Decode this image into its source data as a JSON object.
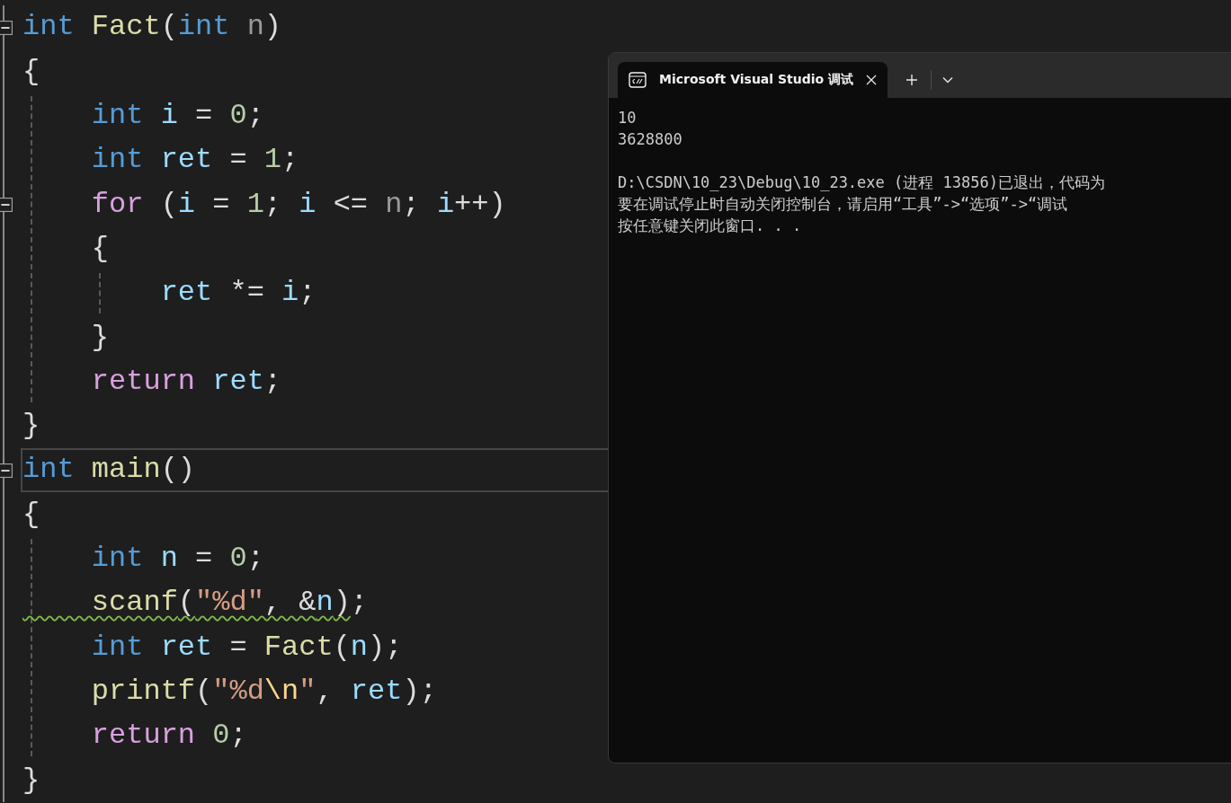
{
  "editor": {
    "lines": [
      {
        "fold": true,
        "current": false,
        "tokens": [
          {
            "kind": "keyword",
            "text": "int "
          },
          {
            "kind": "function",
            "text": "Fact"
          },
          {
            "kind": "plain",
            "text": "("
          },
          {
            "kind": "keyword",
            "text": "int "
          },
          {
            "kind": "param",
            "text": "n"
          },
          {
            "kind": "plain",
            "text": ")"
          }
        ]
      },
      {
        "fold": false,
        "current": false,
        "tokens": [
          {
            "kind": "plain",
            "text": "{"
          }
        ]
      },
      {
        "fold": false,
        "current": false,
        "tokens": [
          {
            "kind": "keyword",
            "text": "    int "
          },
          {
            "kind": "variable",
            "text": "i"
          },
          {
            "kind": "plain",
            "text": " = "
          },
          {
            "kind": "number",
            "text": "0"
          },
          {
            "kind": "plain",
            "text": ";"
          }
        ]
      },
      {
        "fold": false,
        "current": false,
        "tokens": [
          {
            "kind": "keyword",
            "text": "    int "
          },
          {
            "kind": "variable",
            "text": "ret"
          },
          {
            "kind": "plain",
            "text": " = "
          },
          {
            "kind": "number",
            "text": "1"
          },
          {
            "kind": "plain",
            "text": ";"
          }
        ]
      },
      {
        "fold": true,
        "current": false,
        "tokens": [
          {
            "kind": "control",
            "text": "    for"
          },
          {
            "kind": "plain",
            "text": " ("
          },
          {
            "kind": "variable",
            "text": "i"
          },
          {
            "kind": "plain",
            "text": " = "
          },
          {
            "kind": "number",
            "text": "1"
          },
          {
            "kind": "plain",
            "text": "; "
          },
          {
            "kind": "variable",
            "text": "i"
          },
          {
            "kind": "plain",
            "text": " <= "
          },
          {
            "kind": "param",
            "text": "n"
          },
          {
            "kind": "plain",
            "text": "; "
          },
          {
            "kind": "variable",
            "text": "i"
          },
          {
            "kind": "plain",
            "text": "++)"
          }
        ]
      },
      {
        "fold": false,
        "current": false,
        "tokens": [
          {
            "kind": "plain",
            "text": "    {"
          }
        ]
      },
      {
        "fold": false,
        "current": false,
        "tokens": [
          {
            "kind": "variable",
            "text": "        ret"
          },
          {
            "kind": "plain",
            "text": " *= "
          },
          {
            "kind": "variable",
            "text": "i"
          },
          {
            "kind": "plain",
            "text": ";"
          }
        ]
      },
      {
        "fold": false,
        "current": false,
        "tokens": [
          {
            "kind": "plain",
            "text": "    }"
          }
        ]
      },
      {
        "fold": false,
        "current": false,
        "tokens": [
          {
            "kind": "control",
            "text": "    return "
          },
          {
            "kind": "variable",
            "text": "ret"
          },
          {
            "kind": "plain",
            "text": ";"
          }
        ]
      },
      {
        "fold": false,
        "current": false,
        "tokens": [
          {
            "kind": "plain",
            "text": "}"
          }
        ]
      },
      {
        "fold": true,
        "current": true,
        "tokens": [
          {
            "kind": "keyword",
            "text": "int "
          },
          {
            "kind": "function",
            "text": "main"
          },
          {
            "kind": "plain",
            "text": "()"
          }
        ]
      },
      {
        "fold": false,
        "current": false,
        "tokens": [
          {
            "kind": "plain",
            "text": "{"
          }
        ]
      },
      {
        "fold": false,
        "current": false,
        "tokens": [
          {
            "kind": "keyword",
            "text": "    int "
          },
          {
            "kind": "variable",
            "text": "n"
          },
          {
            "kind": "plain",
            "text": " = "
          },
          {
            "kind": "number",
            "text": "0"
          },
          {
            "kind": "plain",
            "text": ";"
          }
        ]
      },
      {
        "fold": false,
        "current": false,
        "tokens": [
          {
            "kind": "function",
            "text": "    scanf",
            "warning": true
          },
          {
            "kind": "plain",
            "text": "(",
            "warning": true
          },
          {
            "kind": "string",
            "text": "\"%d\"",
            "warning": true
          },
          {
            "kind": "plain",
            "text": ", &",
            "warning": true
          },
          {
            "kind": "variable",
            "text": "n",
            "warning": true
          },
          {
            "kind": "plain",
            "text": ")",
            "warning": true
          },
          {
            "kind": "plain",
            "text": ";",
            "warning": false
          }
        ]
      },
      {
        "fold": false,
        "current": false,
        "tokens": [
          {
            "kind": "keyword",
            "text": "    int "
          },
          {
            "kind": "variable",
            "text": "ret"
          },
          {
            "kind": "plain",
            "text": " = "
          },
          {
            "kind": "function",
            "text": "Fact"
          },
          {
            "kind": "plain",
            "text": "("
          },
          {
            "kind": "variable",
            "text": "n"
          },
          {
            "kind": "plain",
            "text": ");"
          }
        ]
      },
      {
        "fold": false,
        "current": false,
        "tokens": [
          {
            "kind": "function",
            "text": "    printf"
          },
          {
            "kind": "plain",
            "text": "("
          },
          {
            "kind": "string",
            "text": "\"%d"
          },
          {
            "kind": "escape",
            "text": "\\n"
          },
          {
            "kind": "string",
            "text": "\""
          },
          {
            "kind": "plain",
            "text": ", "
          },
          {
            "kind": "variable",
            "text": "ret"
          },
          {
            "kind": "plain",
            "text": ");"
          }
        ]
      },
      {
        "fold": false,
        "current": false,
        "tokens": [
          {
            "kind": "control",
            "text": "    return "
          },
          {
            "kind": "number",
            "text": "0"
          },
          {
            "kind": "plain",
            "text": ";"
          }
        ]
      },
      {
        "fold": false,
        "current": false,
        "tokens": [
          {
            "kind": "plain",
            "text": "}"
          }
        ]
      }
    ]
  },
  "console": {
    "tab": {
      "title": "Microsoft Visual Studio 调试",
      "selected": true
    },
    "output": [
      "10",
      "3628800"
    ],
    "messages": [
      "D:\\CSDN\\10_23\\Debug\\10_23.exe (进程 13856)已退出，代码为",
      "要在调试停止时自动关闭控制台，请启用“工具”->“选项”->“调试",
      "按任意键关闭此窗口. . ."
    ]
  }
}
